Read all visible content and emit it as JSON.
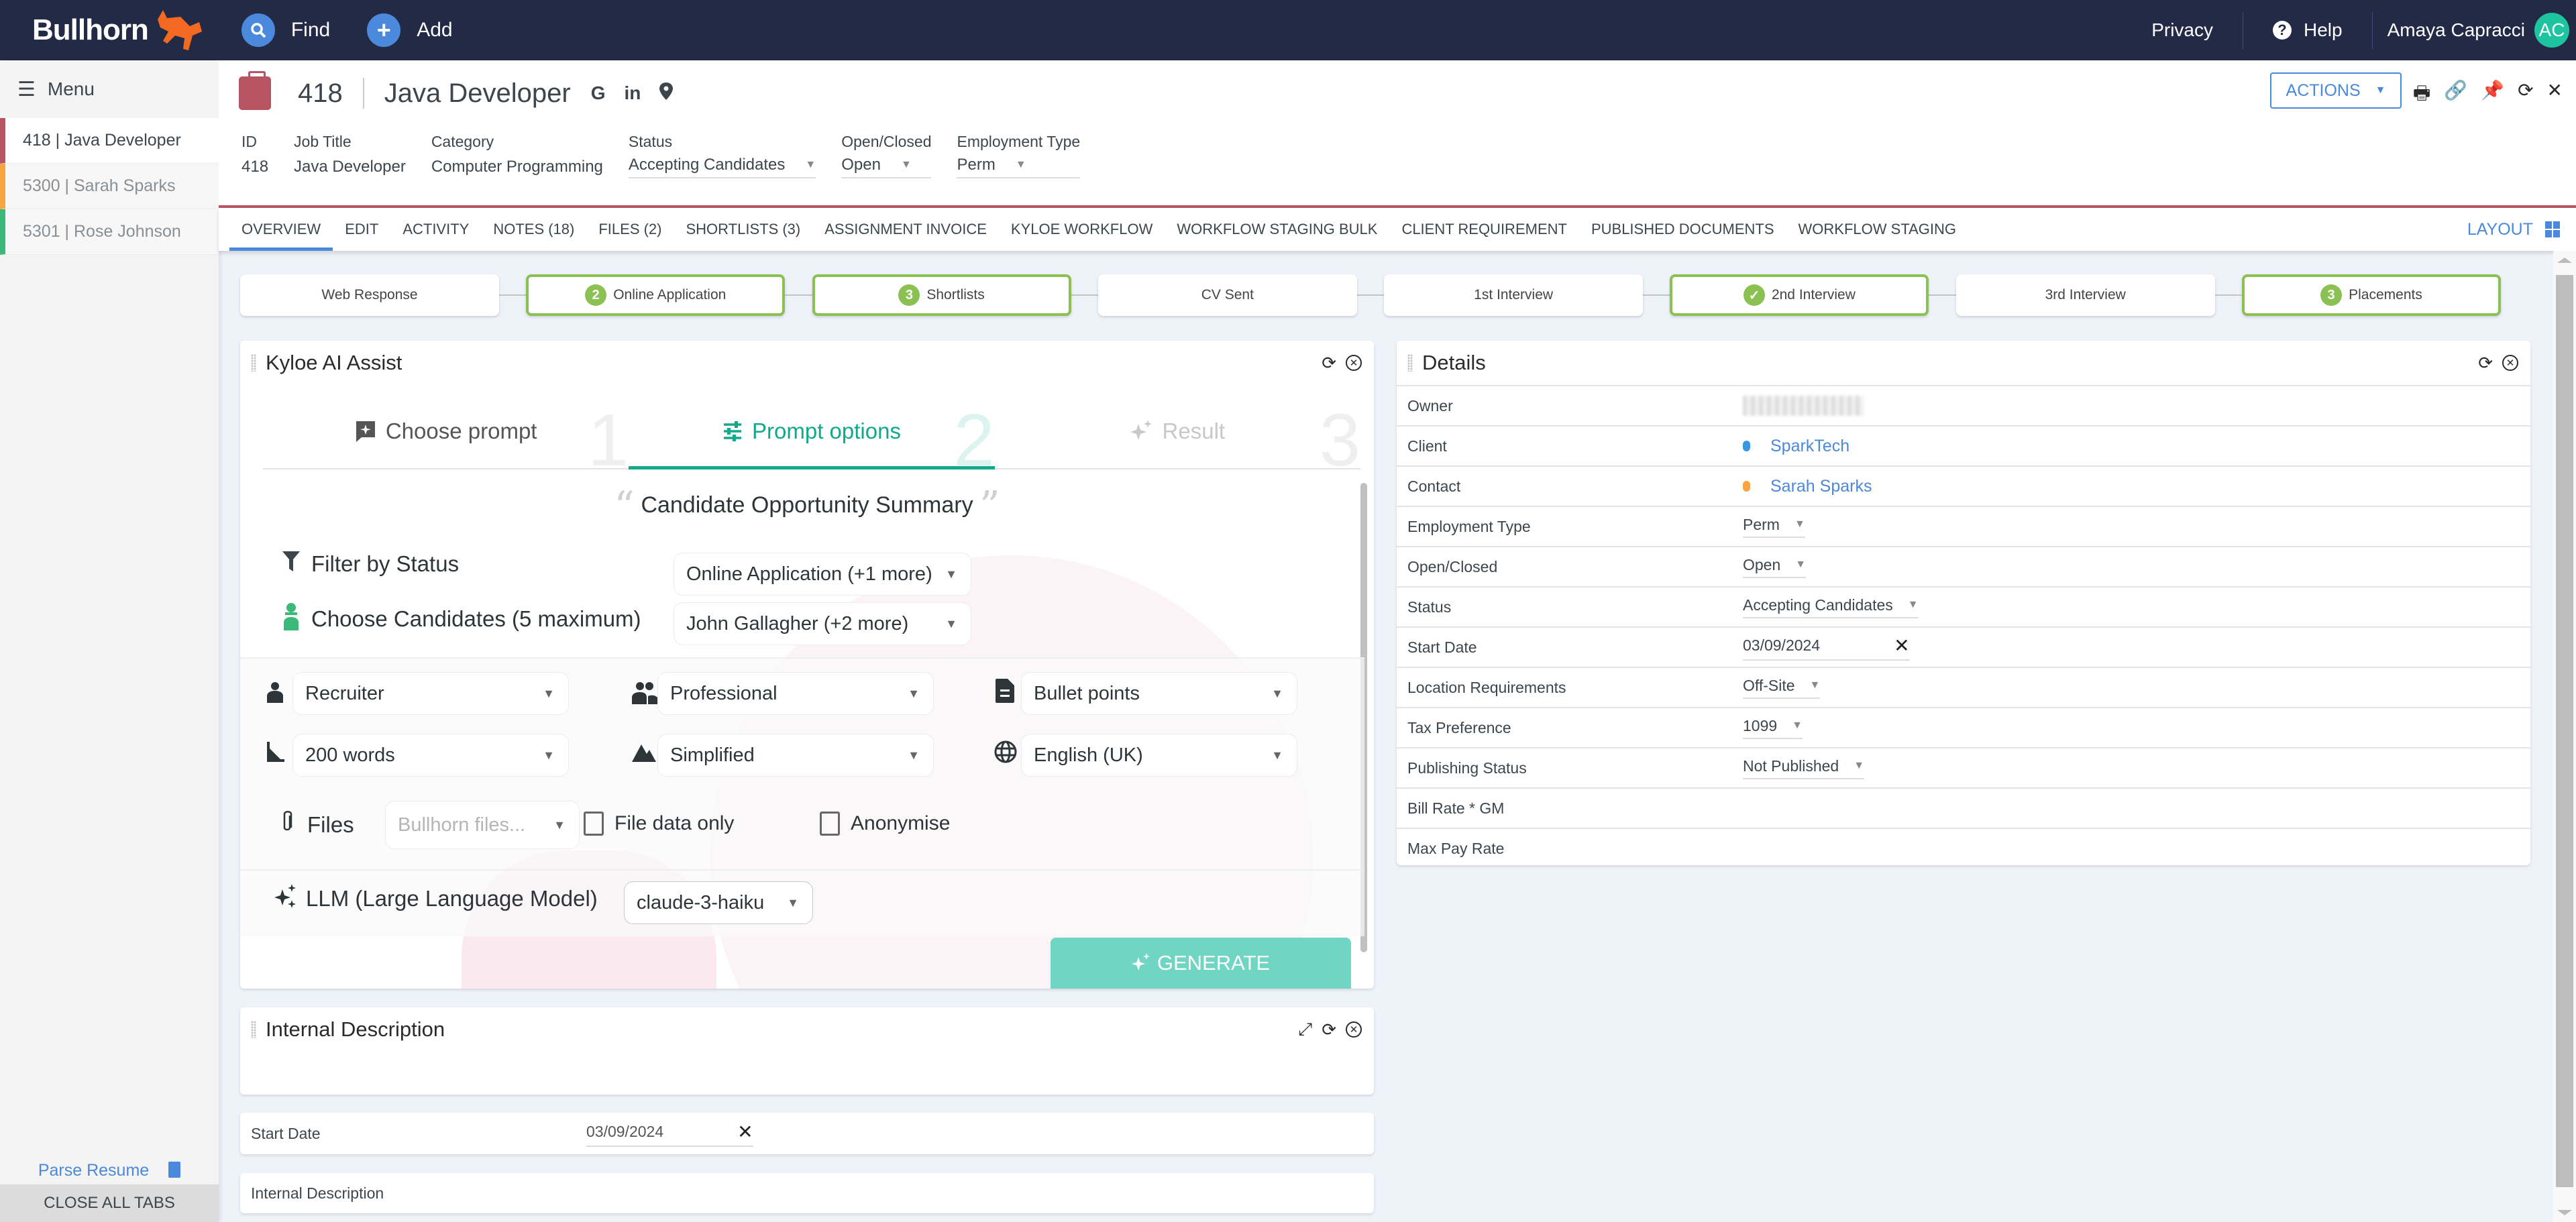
{
  "topnav": {
    "brand": "Bullhorn",
    "find_label": "Find",
    "add_label": "Add",
    "privacy_label": "Privacy",
    "help_label": "Help",
    "user_name": "Amaya Capracci",
    "user_initials": "AC"
  },
  "sidebar": {
    "menu_label": "Menu",
    "tabs": [
      {
        "label": "418 | Java Developer",
        "color": "#b85565"
      },
      {
        "label": "5300 | Sarah Sparks",
        "color": "#f7a540"
      },
      {
        "label": "5301 | Rose Johnson",
        "color": "#3cb878"
      }
    ],
    "parse_resume": "Parse Resume",
    "close_all": "CLOSE ALL TABS"
  },
  "record": {
    "id": "418",
    "title": "Java Developer",
    "actions_label": "ACTIONS",
    "fields": [
      {
        "label": "ID",
        "value": "418",
        "select": false
      },
      {
        "label": "Job Title",
        "value": "Java Developer",
        "select": false
      },
      {
        "label": "Category",
        "value": "Computer Programming",
        "select": false
      },
      {
        "label": "Status",
        "value": "Accepting Candidates",
        "select": true
      },
      {
        "label": "Open/Closed",
        "value": "Open",
        "select": true
      },
      {
        "label": "Employment Type",
        "value": "Perm",
        "select": true
      }
    ]
  },
  "tabs": {
    "items": [
      "OVERVIEW",
      "EDIT",
      "ACTIVITY",
      "NOTES (18)",
      "FILES (2)",
      "SHORTLISTS (3)",
      "ASSIGNMENT INVOICE",
      "KYLOE WORKFLOW",
      "WORKFLOW STAGING BULK",
      "CLIENT REQUIREMENT",
      "PUBLISHED DOCUMENTS",
      "WORKFLOW STAGING"
    ],
    "active": 0,
    "layout_label": "LAYOUT"
  },
  "stages": [
    {
      "label": "Web Response",
      "badge": null,
      "done": false
    },
    {
      "label": "Online Application",
      "badge": "2",
      "done": true
    },
    {
      "label": "Shortlists",
      "badge": "3",
      "done": true
    },
    {
      "label": "CV Sent",
      "badge": null,
      "done": false
    },
    {
      "label": "1st Interview",
      "badge": null,
      "done": false
    },
    {
      "label": "2nd Interview",
      "badge": "✓",
      "done": true
    },
    {
      "label": "3rd Interview",
      "badge": null,
      "done": false
    },
    {
      "label": "Placements",
      "badge": "3",
      "done": true
    }
  ],
  "ai_assist": {
    "title": "Kyloe AI Assist",
    "steps": [
      {
        "label": "Choose prompt",
        "num": "1",
        "icon": "comment-plus-icon"
      },
      {
        "label": "Prompt options",
        "num": "2",
        "icon": "sliders-icon"
      },
      {
        "label": "Result",
        "num": "3",
        "icon": "sparkles-icon"
      }
    ],
    "prompt_title": "Candidate Opportunity Summary",
    "filter_status_label": "Filter by Status",
    "filter_status_value": "Online Application (+1 more)",
    "candidates_label": "Choose Candidates (5 maximum)",
    "candidates_value": "John Gallagher (+2 more)",
    "audience": "Recruiter",
    "tone": "Professional",
    "format": "Bullet points",
    "length": "200 words",
    "complexity": "Simplified",
    "language": "English (UK)",
    "files_label": "Files",
    "files_placeholder": "Bullhorn files...",
    "file_data_only_label": "File data only",
    "anonymise_label": "Anonymise",
    "llm_label": "LLM (Large Language Model)",
    "llm_value": "claude-3-haiku",
    "generate_label": "GENERATE"
  },
  "details": {
    "title": "Details",
    "rows": [
      {
        "label": "Owner",
        "value": "",
        "type": "blurred"
      },
      {
        "label": "Client",
        "value": "SparkTech",
        "type": "link",
        "dot": "#3b96e0"
      },
      {
        "label": "Contact",
        "value": "Sarah Sparks",
        "type": "link",
        "dot": "#f7a540"
      },
      {
        "label": "Employment Type",
        "value": "Perm",
        "type": "select"
      },
      {
        "label": "Open/Closed",
        "value": "Open",
        "type": "select"
      },
      {
        "label": "Status",
        "value": "Accepting Candidates",
        "type": "select"
      },
      {
        "label": "Start Date",
        "value": "03/09/2024",
        "type": "date"
      },
      {
        "label": "Location Requirements",
        "value": "Off-Site",
        "type": "select"
      },
      {
        "label": "Tax Preference",
        "value": "1099",
        "type": "select"
      },
      {
        "label": "Publishing Status",
        "value": "Not Published",
        "type": "select"
      },
      {
        "label": "Bill Rate * GM",
        "value": "",
        "type": "text"
      },
      {
        "label": "Max Pay Rate",
        "value": "",
        "type": "text"
      }
    ]
  },
  "internal_description": {
    "title": "Internal Description"
  },
  "start_date_card": {
    "label": "Start Date",
    "value": "03/09/2024"
  },
  "internal_description_card": {
    "label": "Internal Description"
  }
}
